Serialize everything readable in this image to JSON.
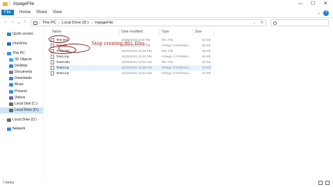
{
  "window": {
    "title": "InpageFile",
    "controls": [
      "—",
      "☐",
      "✕"
    ]
  },
  "ribbon": {
    "tabs": [
      "File",
      "Home",
      "Share",
      "View"
    ]
  },
  "address": {
    "crumbs": [
      "This PC",
      "Local Drive (D:)",
      "InpageFile"
    ],
    "search_placeholder": ""
  },
  "sidebar": {
    "items": [
      {
        "label": "Quick access",
        "icon": "star-icon",
        "color": "#2b7cd3",
        "indent": 0
      },
      {
        "label": "OneDrive",
        "icon": "cloud-icon",
        "color": "#1f6fd6",
        "indent": 0
      },
      {
        "label": "This PC",
        "icon": "computer-icon",
        "color": "#3b8ede",
        "indent": 0
      },
      {
        "label": "3D Objects",
        "icon": "cube-icon",
        "color": "#4aa3df",
        "indent": 1
      },
      {
        "label": "Desktop",
        "icon": "desktop-icon",
        "color": "#2f86d6",
        "indent": 1
      },
      {
        "label": "Documents",
        "icon": "documents-icon",
        "color": "#6a7f99",
        "indent": 1
      },
      {
        "label": "Downloads",
        "icon": "download-icon",
        "color": "#2f86d6",
        "indent": 1
      },
      {
        "label": "Music",
        "icon": "music-icon",
        "color": "#3b8ede",
        "indent": 1
      },
      {
        "label": "Pictures",
        "icon": "pictures-icon",
        "color": "#3b8ede",
        "indent": 1
      },
      {
        "label": "Videos",
        "icon": "videos-icon",
        "color": "#7a5fc0",
        "indent": 1
      },
      {
        "label": "Local Disk (C:)",
        "icon": "drive-icon",
        "color": "#666666",
        "indent": 1
      },
      {
        "label": "Local Drive (D:)",
        "icon": "drive-icon",
        "color": "#666666",
        "indent": 1,
        "selected": true
      },
      {
        "label": "Local Drive (D:)",
        "icon": "drive-icon",
        "color": "#666666",
        "indent": 0
      },
      {
        "label": "Network",
        "icon": "network-icon",
        "color": "#3b8ede",
        "indent": 0
      }
    ]
  },
  "columns": {
    "name": "Name",
    "date": "Date modified",
    "type": "Type",
    "size": "Size"
  },
  "files": [
    {
      "name": "Test.801",
      "date": "10/25/2022 3:40 PM",
      "type": "801 File",
      "size": "32 KB"
    },
    {
      "name": "Test.inp",
      "date": "10/25/2022 3:40 PM",
      "type": "InPage 3 Professio...",
      "size": "32 KB"
    },
    {
      "name": "Test1.801",
      "date": "10/25/2022 11:52 PM",
      "type": "801 File",
      "size": "48 KB"
    },
    {
      "name": "Test1.inp",
      "date": "10/25/2022 11:52 PM",
      "type": "InPage 3 Professio...",
      "size": "48 KB"
    },
    {
      "name": "Test3.801",
      "date": "10/26/2022 12:00 AM",
      "type": "801 File",
      "size": "16 KB"
    },
    {
      "name": "Test3.inp",
      "date": "10/26/2022 12:00 AM",
      "type": "InPage 3 Professio...",
      "size": "16 KB"
    },
    {
      "name": "Test4.inp",
      "date": "10/26/2022 12:01 AM",
      "type": "InPage 3 Professio...",
      "size": "16 KB"
    }
  ],
  "annotation": {
    "text": "Stop creating 801 files",
    "color": "#b22222"
  },
  "status": {
    "text": "7 items"
  }
}
